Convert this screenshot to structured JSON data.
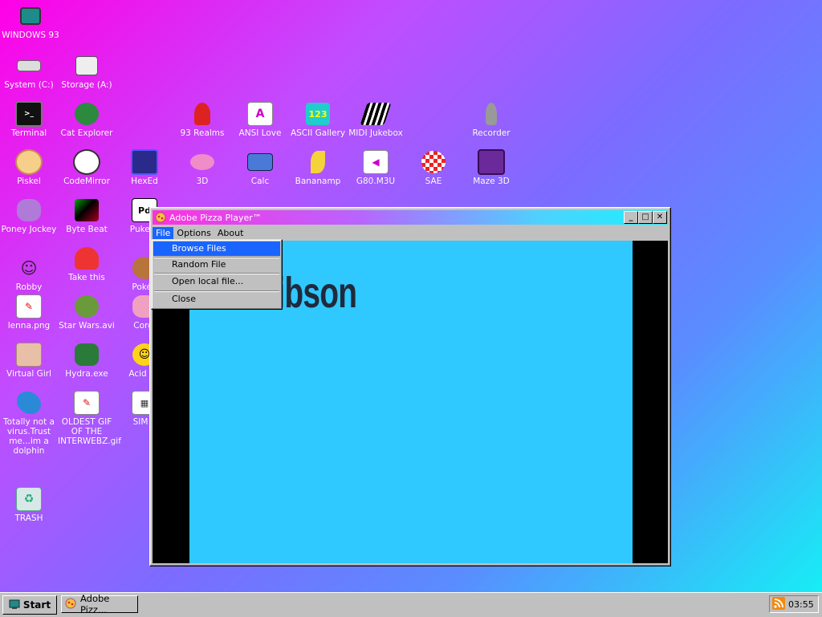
{
  "desktop": {
    "icons": [
      {
        "label": "WINDOWS 93",
        "icon": "computer-icon"
      },
      {
        "label": "System (C:)",
        "icon": "drive-icon"
      },
      {
        "label": "Storage (A:)",
        "icon": "floppy-icon"
      },
      {
        "label": "Terminal",
        "icon": "terminal-icon"
      },
      {
        "label": "Cat Explorer",
        "icon": "cat-globe-icon"
      },
      {
        "label": "93 Realms",
        "icon": "realms-icon"
      },
      {
        "label": "ANSI Love",
        "icon": "ansi-icon"
      },
      {
        "label": "ASCII Gallery",
        "icon": "ascii-icon"
      },
      {
        "label": "MIDI Jukebox",
        "icon": "piano-icon"
      },
      {
        "label": "Recorder",
        "icon": "microphone-icon"
      },
      {
        "label": "Piskel",
        "icon": "palette-icon"
      },
      {
        "label": "CodeMirror",
        "icon": "cat-mirror-icon"
      },
      {
        "label": "HexEd",
        "icon": "cube-icon"
      },
      {
        "label": "3D",
        "icon": "teapot-icon"
      },
      {
        "label": "Calc",
        "icon": "calculator-icon"
      },
      {
        "label": "Bananamp",
        "icon": "banana-icon"
      },
      {
        "label": "G80.M3U",
        "icon": "playlist-icon"
      },
      {
        "label": "SAE",
        "icon": "ball-icon"
      },
      {
        "label": "Maze 3D",
        "icon": "maze-icon"
      },
      {
        "label": "Poney Jockey",
        "icon": "pony-icon"
      },
      {
        "label": "Byte Beat",
        "icon": "bytebeat-icon"
      },
      {
        "label": "Puke D",
        "icon": "puredata-icon"
      },
      {
        "label": "Robby",
        "icon": "stickman-icon"
      },
      {
        "label": "Take this",
        "icon": "character-icon"
      },
      {
        "label": "Pokég",
        "icon": "pokeg-icon"
      },
      {
        "label": "lenna.png",
        "icon": "image-file-icon"
      },
      {
        "label": "Star Wars.avi",
        "icon": "yoda-icon"
      },
      {
        "label": "Corgi",
        "icon": "corgi-icon"
      },
      {
        "label": "Virtual Girl",
        "icon": "face-icon"
      },
      {
        "label": "Hydra.exe",
        "icon": "hydra-icon"
      },
      {
        "label": "Acid Bo",
        "icon": "smiley-icon"
      },
      {
        "label": "Totally not a virus.Trust me...im a dolphin",
        "icon": "dolphin-icon"
      },
      {
        "label": "OLDEST GIF OF THE INTERWEBZ.gif",
        "icon": "gif-file-icon"
      },
      {
        "label": "SIM S",
        "icon": "sim-icon"
      },
      {
        "label": "TRASH",
        "icon": "trash-icon"
      }
    ]
  },
  "window": {
    "title": "Adobe Pizza Player™",
    "menu": [
      "File",
      "Options",
      "About"
    ],
    "controls": {
      "minimize": "_",
      "maximize": "□",
      "close": "✕"
    },
    "video_text": "Mel Gibson"
  },
  "dropdown": {
    "items": [
      "Browse Files",
      "Random File",
      "Open local file...",
      "Close"
    ]
  },
  "taskbar": {
    "start_label": "Start",
    "task_label": "Adobe Pizz...",
    "clock": "03:55"
  }
}
